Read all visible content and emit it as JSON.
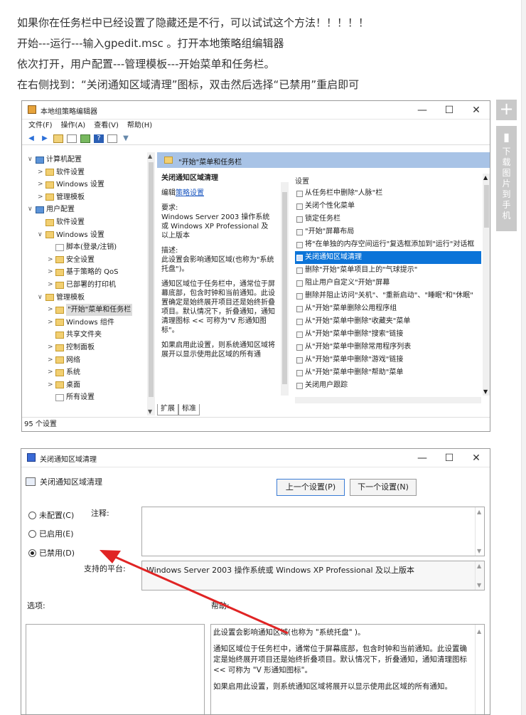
{
  "article": {
    "line1": "如果你在任务栏中已经设置了隐藏还是不行，可以试试这个方法！！！！！",
    "line2": "开始---运行---输入gpedit.msc 。打开本地策略组编辑器",
    "line3": "依次打开，用户配置---管理模板---开始菜单和任务栏。",
    "line4": "在右侧找到：“关闭通知区域清理”图标，双击然后选择“已禁用”重启即可"
  },
  "side_toolbar": {
    "plus": "+",
    "download_label": "下载图片到手机"
  },
  "window_controls": {
    "minimize": "—",
    "maximize": "☐",
    "close": "✕"
  },
  "gpedit": {
    "title": "本地组策略编辑器",
    "menu": [
      "文件(F)",
      "操作(A)",
      "查看(V)",
      "帮助(H)"
    ],
    "tree": [
      {
        "arrow": "∨",
        "label": "计算机配置",
        "icon": "computer-icon"
      },
      {
        "arrow": ">",
        "label": "软件设置",
        "icon": "folder-icon"
      },
      {
        "arrow": ">",
        "label": "Windows 设置",
        "icon": "folder-icon"
      },
      {
        "arrow": ">",
        "label": "管理模板",
        "icon": "folder-icon"
      },
      {
        "arrow": "∨",
        "label": "用户配置",
        "icon": "user-icon"
      },
      {
        "arrow": "",
        "label": "软件设置",
        "icon": "folder-icon"
      },
      {
        "arrow": "∨",
        "label": "Windows 设置",
        "icon": "folder-icon"
      },
      {
        "arrow": "",
        "label": "脚本(登录/注销)",
        "icon": "script-icon"
      },
      {
        "arrow": ">",
        "label": "安全设置",
        "icon": "security-icon"
      },
      {
        "arrow": ">",
        "label": "基于策略的 QoS",
        "icon": "chart-icon"
      },
      {
        "arrow": ">",
        "label": "已部署的打印机",
        "icon": "printer-icon"
      },
      {
        "arrow": "∨",
        "label": "管理模板",
        "icon": "folder-icon"
      },
      {
        "arrow": ">",
        "label": "\"开始\"菜单和任务栏",
        "icon": "folder-icon"
      },
      {
        "arrow": ">",
        "label": "Windows 组件",
        "icon": "folder-icon"
      },
      {
        "arrow": "",
        "label": "共享文件夹",
        "icon": "folder-icon"
      },
      {
        "arrow": ">",
        "label": "控制面板",
        "icon": "folder-icon"
      },
      {
        "arrow": ">",
        "label": "网络",
        "icon": "folder-icon"
      },
      {
        "arrow": ">",
        "label": "系统",
        "icon": "folder-icon"
      },
      {
        "arrow": ">",
        "label": "桌面",
        "icon": "folder-icon"
      },
      {
        "arrow": "",
        "label": "所有设置",
        "icon": "settings-icon"
      }
    ],
    "right_header": "\"开始\"菜单和任务栏",
    "desc": {
      "title": "关闭通知区域清理",
      "edit_prefix": "编辑",
      "edit_link": "策略设置",
      "req_label": "要求:",
      "req_text": "Windows Server 2003 操作系统或 Windows XP Professional 及以上版本",
      "desc_label": "描述:",
      "desc_text": "此设置会影响通知区域(也称为\"系统托盘\")。",
      "para": "通知区域位于任务栏中，通常位于屏幕底部，包含时钟和当前通知。此设置确定是始终展开项目还是始终折叠项目。默认情况下，折叠通知，通知清理图标 << 可称为\"V 形通知图标\"。",
      "para2": "如果启用此设置，则系统通知区域将展开以显示使用此区域的所有通"
    },
    "list_header": "设置",
    "settings": [
      "从任务栏中删除\"人脉\"栏",
      "关闭个性化菜单",
      "锁定任务栏",
      "\"开始\"屏幕布局",
      "将\"在单独的内存空间运行\"复选框添加到\"运行\"对话框",
      "关闭通知区域清理",
      "删除\"开始\"菜单项目上的\"气球提示\"",
      "阻止用户自定义\"开始\"屏幕",
      "删除并阻止访问\"关机\"、\"重新启动\"、\"睡眠\"和\"休眠\"",
      "从\"开始\"菜单删除公用程序组",
      "从\"开始\"菜单中删除\"收藏夹\"菜单",
      "从\"开始\"菜单中删除\"搜索\"链接",
      "从\"开始\"菜单中删除常用程序列表",
      "从\"开始\"菜单中删除\"游戏\"链接",
      "从\"开始\"菜单中删除\"帮助\"菜单",
      "关闭用户跟踪"
    ],
    "selected_setting_index": 5,
    "tabs": [
      "扩展",
      "标准"
    ],
    "status": "95 个设置"
  },
  "dialog": {
    "title": "关闭通知区域清理",
    "header": "关闭通知区域清理",
    "prev_button": "上一个设置(P)",
    "next_button": "下一个设置(N)",
    "radios": [
      {
        "label": "未配置(C)",
        "checked": false
      },
      {
        "label": "已启用(E)",
        "checked": false
      },
      {
        "label": "已禁用(D)",
        "checked": true
      }
    ],
    "comment_label": "注释:",
    "platform_label": "支持的平台:",
    "platform_value": "Windows Server 2003 操作系统或 Windows XP Professional 及以上版本",
    "options_label": "选项:",
    "help_label": "帮助:",
    "help_p1": "此设置会影响通知区域(也称为 \"系统托盘\" )。",
    "help_p2": "通知区域位于任务栏中，通常位于屏幕底部，包含时钟和当前通知。此设置确定是始终展开项目还是始终折叠项目。默认情况下，折叠通知，通知清理图标 << 可称为 \"V 形通知图标\"。",
    "help_p3": "如果启用此设置，则系统通知区域将展开以显示使用此区域的所有通知。"
  },
  "colors": {
    "selection": "#0c74d8",
    "header_band": "#a8c3e6",
    "arrow": "#e02424"
  }
}
